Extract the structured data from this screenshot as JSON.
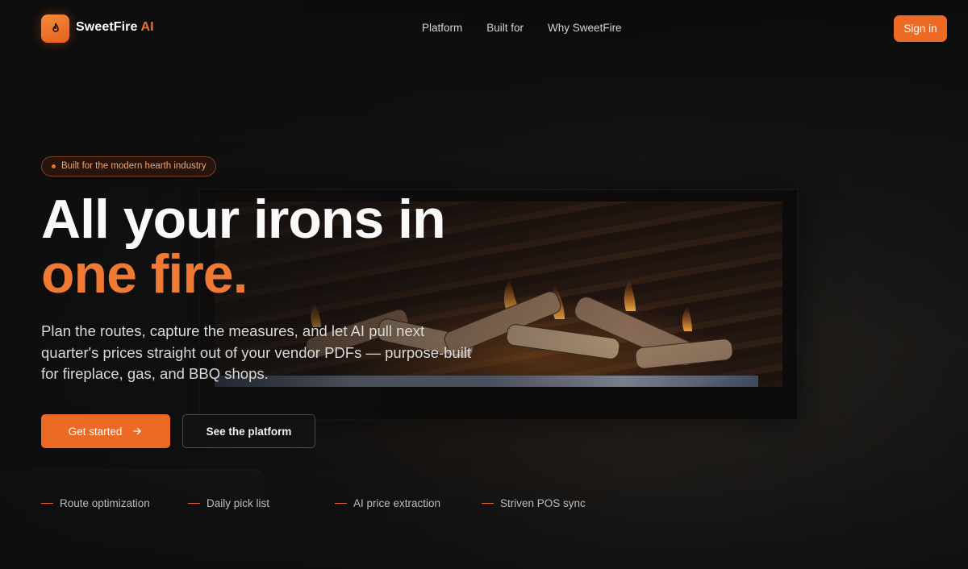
{
  "nav": {
    "brand_name": "SweetFire",
    "brand_accent": "AI",
    "links": [
      "Platform",
      "Built for",
      "Why SweetFire"
    ],
    "signin_label": "Sign in"
  },
  "hero": {
    "badge": "Built for the modern hearth industry",
    "headline_line1": "All your irons in",
    "headline_line2": "one fire.",
    "subtitle": "Plan the routes, capture the measures, and let AI pull next quarter's prices straight out of your vendor PDFs — purpose-built for fireplace, gas, and BBQ shops.",
    "primary_cta": "Get started",
    "secondary_cta": "See the platform"
  },
  "features": [
    "Route optimization",
    "Daily pick list",
    "AI price extraction",
    "Striven POS sync"
  ],
  "icons": {
    "logo": "flame-icon",
    "primary_cta": "arrow-right-icon",
    "badge": "dot-icon"
  },
  "colors": {
    "accent": "#ec6a24",
    "headline_accent": "#f07a34",
    "background": "#141414"
  }
}
